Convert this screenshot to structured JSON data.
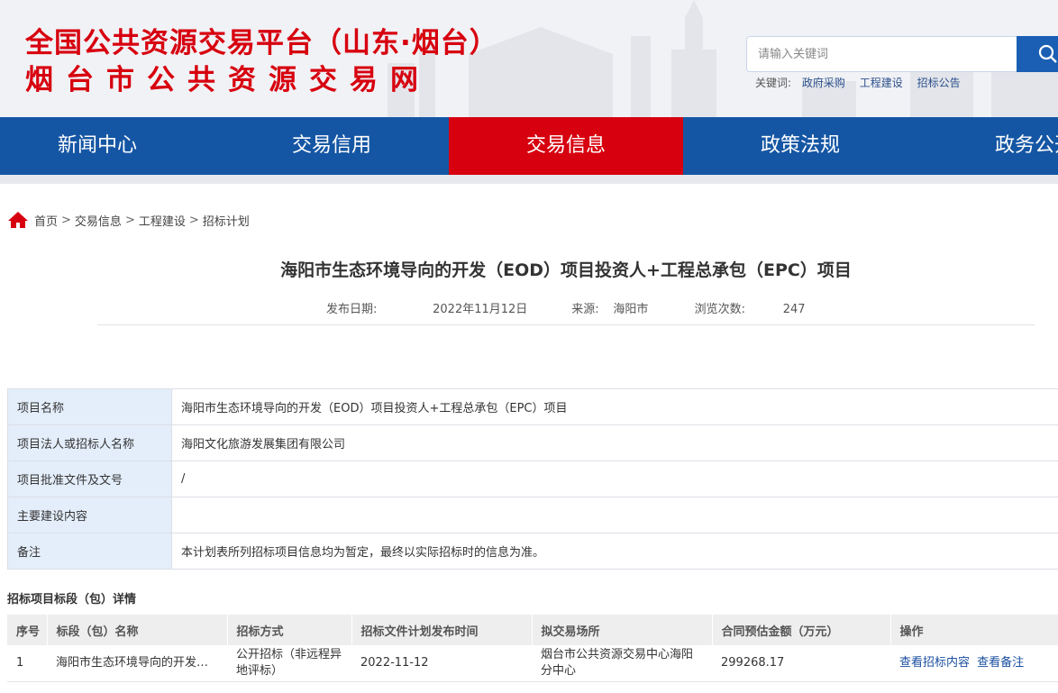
{
  "header": {
    "title_line1": "全国公共资源交易平台（山东·烟台）",
    "title_line2": "烟台市公共资源交易网",
    "search_placeholder": "请输入关键词",
    "keywords_label": "关键词:",
    "keywords": [
      "政府采购",
      "工程建设",
      "招标公告"
    ]
  },
  "nav": {
    "items": [
      "新闻中心",
      "交易信用",
      "交易信息",
      "政策法规",
      "政务公开"
    ],
    "active_index": 2
  },
  "breadcrumb": [
    "首页",
    "交易信息",
    "工程建设",
    "招标计划"
  ],
  "article": {
    "title": "海阳市生态环境导向的开发（EOD）项目投资人+工程总承包（EPC）项目",
    "date_label": "发布日期:",
    "date": "2022年11月12日",
    "source_label": "来源:",
    "source": "海阳市",
    "views_label": "浏览次数:",
    "views": "247"
  },
  "info_table": [
    {
      "key": "项目名称",
      "value": "海阳市生态环境导向的开发（EOD）项目投资人+工程总承包（EPC）项目"
    },
    {
      "key": "项目法人或招标人名称",
      "value": "海阳文化旅游发展集团有限公司"
    },
    {
      "key": "项目批准文件及文号",
      "value": "/"
    },
    {
      "key": "主要建设内容",
      "value": ""
    },
    {
      "key": "备注",
      "value": "本计划表所列招标项目信息均为暂定，最终以实际招标时的信息为准。"
    }
  ],
  "section_title": "招标项目标段（包）详情",
  "bid_table": {
    "headers": [
      "序号",
      "标段（包）名称",
      "招标方式",
      "招标文件计划发布时间",
      "拟交易场所",
      "合同预估金额（万元）",
      "操作"
    ],
    "rows": [
      {
        "no": "1",
        "name": "海阳市生态环境导向的开发（EOD）项目投资人+工程总承包（EPC）项目",
        "method": "公开招标（非远程异地评标）",
        "publish_time": "2022-11-12",
        "venue": "烟台市公共资源交易中心海阳分中心",
        "amount": "299268.17",
        "op1": "查看招标内容",
        "op2": "查看备注"
      }
    ]
  },
  "colors": {
    "brand_red": "#d7000f",
    "nav_blue": "#1556a4",
    "label_bg": "#e4eefb"
  }
}
